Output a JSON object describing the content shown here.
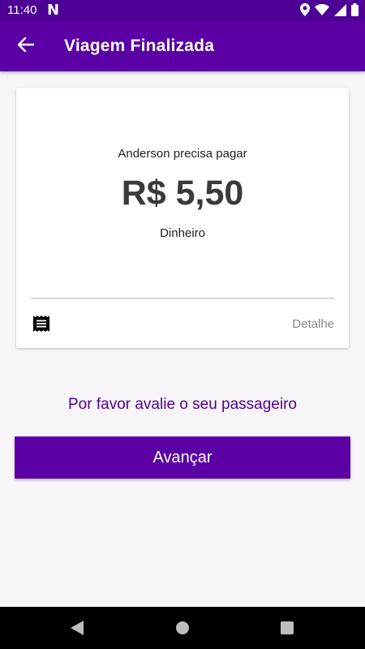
{
  "status_bar": {
    "time": "11:40",
    "notification_letter": "N",
    "icons": [
      "location-icon",
      "wifi-icon",
      "signal-icon",
      "battery-icon"
    ]
  },
  "app_bar": {
    "title": "Viagem Finalizada",
    "back_icon": "arrow-left-icon"
  },
  "card": {
    "subtitle": "Anderson precisa pagar",
    "amount": "R$ 5,50",
    "payment_method": "Dinheiro",
    "receipt_icon": "receipt-icon",
    "detail_label": "Detalhe"
  },
  "rating_prompt": "Por favor avalie o seu passageiro",
  "advance_button": "Avançar",
  "nav": [
    "back-icon",
    "home-icon",
    "recents-icon"
  ],
  "colors": {
    "primary": "#5b00a5",
    "primary_dark": "#4e0096",
    "background": "#f7f5f7"
  }
}
